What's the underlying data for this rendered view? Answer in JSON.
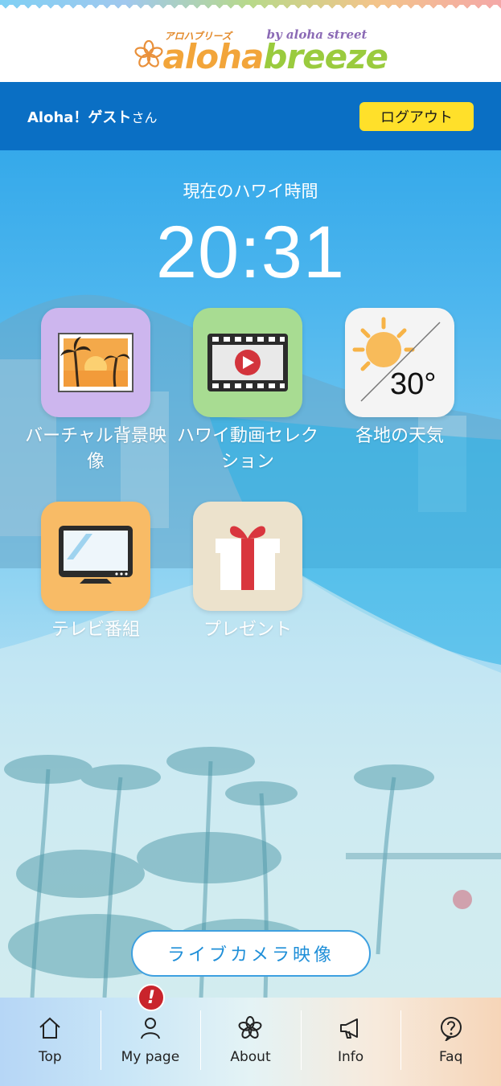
{
  "header": {
    "logo_ruby": "アロハブリーズ",
    "logo_by": "by aloha street",
    "logo_main_a": "aloha",
    "logo_main_b": "breeze"
  },
  "userbar": {
    "greeting": "Aloha！ゲスト",
    "greeting_suffix": "さん",
    "logout_label": "ログアウト"
  },
  "clock": {
    "label": "現在のハワイ時間",
    "time": "20:31"
  },
  "tiles": [
    {
      "label": "バーチャル背景映像",
      "icon": "palm-sunset-icon"
    },
    {
      "label": "ハワイ動画セレクション",
      "icon": "film-play-icon"
    },
    {
      "label": "各地の天気",
      "icon": "weather-sun-icon",
      "temperature": "30°"
    },
    {
      "label": "テレビ番組",
      "icon": "tv-icon"
    },
    {
      "label": "プレゼント",
      "icon": "gift-icon"
    }
  ],
  "live_camera": {
    "label": "ライブカメラ映像"
  },
  "nav": {
    "items": [
      {
        "label": "Top",
        "icon": "home-icon"
      },
      {
        "label": "My page",
        "icon": "user-icon"
      },
      {
        "label": "About",
        "icon": "flower-icon"
      },
      {
        "label": "Info",
        "icon": "megaphone-icon"
      },
      {
        "label": "Faq",
        "icon": "question-icon"
      }
    ],
    "badge": "!"
  },
  "colors": {
    "header_bar": "#0a6fc4",
    "logout_bg": "#ffe02a",
    "badge": "#c9242c",
    "live_text": "#1f8fd8"
  }
}
